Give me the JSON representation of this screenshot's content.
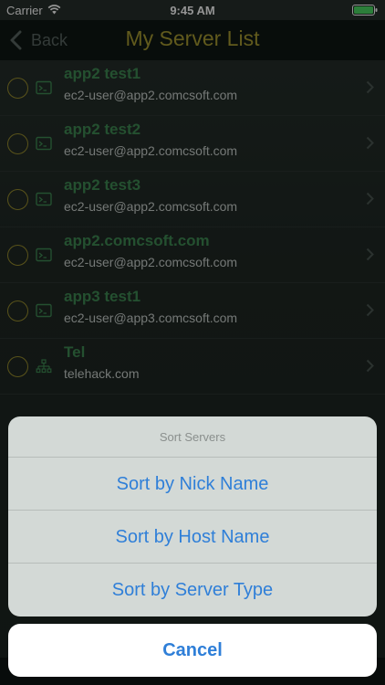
{
  "status_bar": {
    "carrier": "Carrier",
    "time": "9:45 AM"
  },
  "nav": {
    "back_label": "Back",
    "title": "My Server List"
  },
  "servers": [
    {
      "name": "app2 test1",
      "host": "ec2-user@app2.comcsoft.com",
      "icon": "terminal-icon"
    },
    {
      "name": "app2 test2",
      "host": "ec2-user@app2.comcsoft.com",
      "icon": "terminal-icon"
    },
    {
      "name": "app2 test3",
      "host": "ec2-user@app2.comcsoft.com",
      "icon": "terminal-icon"
    },
    {
      "name": "app2.comcsoft.com",
      "host": "ec2-user@app2.comcsoft.com",
      "icon": "terminal-icon"
    },
    {
      "name": "app3 test1",
      "host": "ec2-user@app3.comcsoft.com",
      "icon": "terminal-icon"
    },
    {
      "name": "Tel",
      "host": "telehack.com",
      "icon": "network-icon"
    }
  ],
  "action_sheet": {
    "title": "Sort Servers",
    "options": [
      "Sort by Nick Name",
      "Sort by Host Name",
      "Sort by Server Type"
    ],
    "cancel_label": "Cancel"
  },
  "colors": {
    "accent": "#2f7fd8",
    "title": "#a89c32",
    "server_name": "#3f8a53"
  }
}
